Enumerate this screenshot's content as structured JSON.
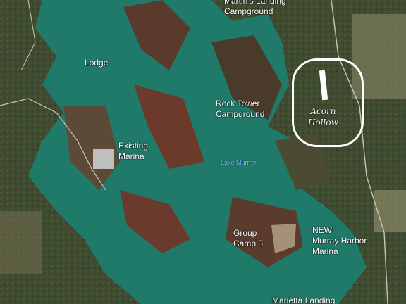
{
  "labels": {
    "martins_landing": [
      "Martin's Landing",
      "Campground"
    ],
    "lodge": "Lodge",
    "rock_tower": [
      "Rock Tower",
      "Campground"
    ],
    "existing_marina": [
      "Existing",
      "Marina"
    ],
    "lake_murray": "Lake Murray",
    "group_camp": [
      "Group",
      "Camp 3"
    ],
    "murray_harbor": [
      "NEW!",
      "Murray Harbor",
      "Marina"
    ],
    "marietta_landing": "Marietta Landing",
    "acorn_hollow": [
      "Acorn",
      "Hollow"
    ]
  },
  "colors": {
    "lake": "#1f7a6a",
    "land_forest": "#3d4a2e",
    "land_autumn": "#6a3a2c",
    "field": "#8a8a6a",
    "annotation": "#ffffff",
    "lake_label": "#6db6ff"
  }
}
